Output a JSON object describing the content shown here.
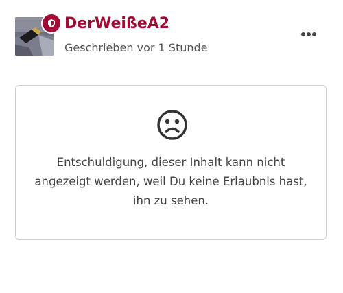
{
  "post": {
    "author": "DerWeißeA2",
    "timestamp": "Geschrieben vor 1 Stunde",
    "avatar_icon": "user-avatar",
    "badge_icon": "moderator-shield-icon",
    "more_icon": "more-dots-icon"
  },
  "notice": {
    "icon": "sad-face-icon",
    "message": "Entschuldigung, dieser Inhalt kann nicht angezeigt werden, weil Du keine Erlaubnis hast, ihn zu sehen."
  },
  "colors": {
    "accent": "#a30d35",
    "text": "#444444",
    "border": "#cfcfcf"
  }
}
